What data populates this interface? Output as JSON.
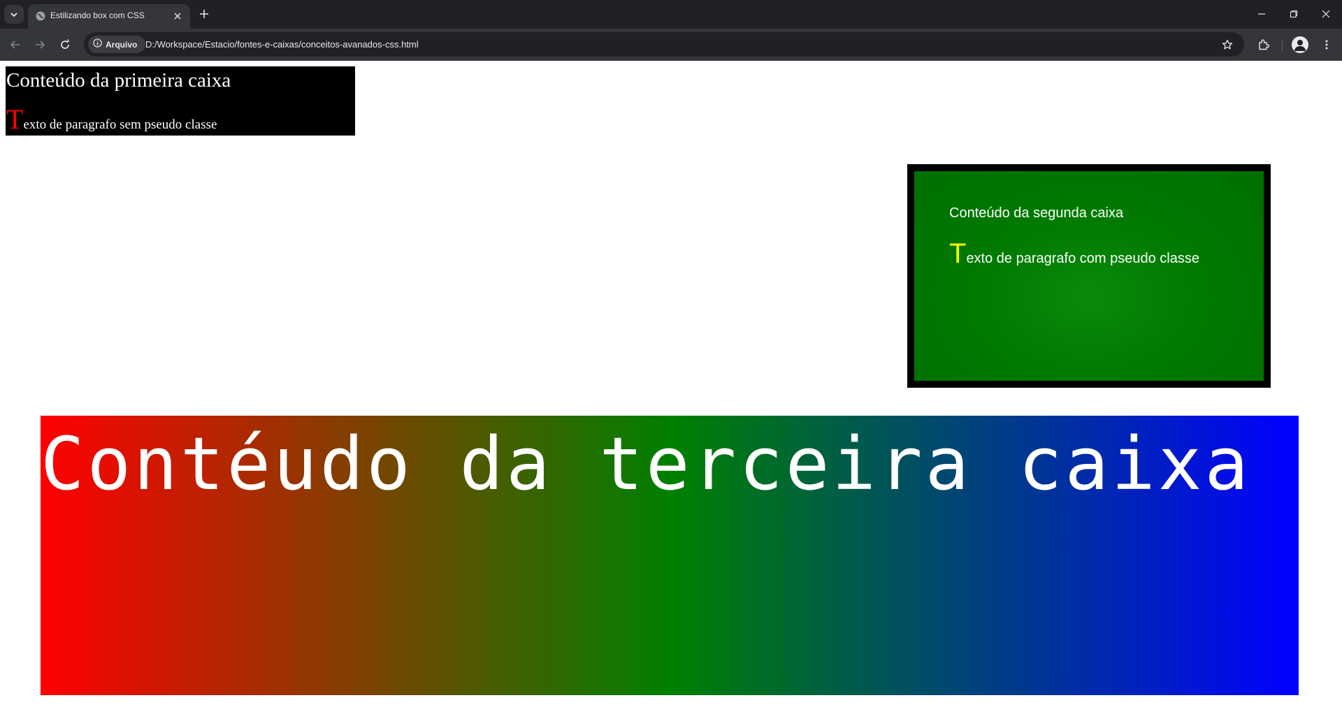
{
  "browser": {
    "tab_title": "Estilizando box com CSS",
    "security_chip": "Arquivo",
    "url": "D:/Workspace/Estacio/fontes-e-caixas/conceitos-avanados-css.html",
    "icons": [
      "tab-search-icon",
      "globe-icon",
      "close-icon",
      "plus-icon",
      "minimize-icon",
      "restore-icon",
      "close-window-icon",
      "back-arrow-icon",
      "forward-arrow-icon",
      "reload-icon",
      "info-icon",
      "star-icon",
      "extensions-icon",
      "profile-icon",
      "more-vert-icon"
    ]
  },
  "box1": {
    "title": "Conteúdo da primeira caixa",
    "paragraph_first_letter": "T",
    "paragraph_rest": "exto de paragrafo sem pseudo classe",
    "background": "#000000",
    "first_letter_color": "#ff0000"
  },
  "box2": {
    "title": "Conteúdo da segunda caixa",
    "paragraph_first_letter": "T",
    "paragraph_rest": "exto de paragrafo com pseudo classe",
    "background": "#007a00",
    "border_color": "#000000",
    "first_letter_color": "#ffff00"
  },
  "box3": {
    "title": "Contéudo da terceira caixa",
    "gradient": [
      "#ff0000",
      "#008000",
      "#0000ff"
    ]
  }
}
